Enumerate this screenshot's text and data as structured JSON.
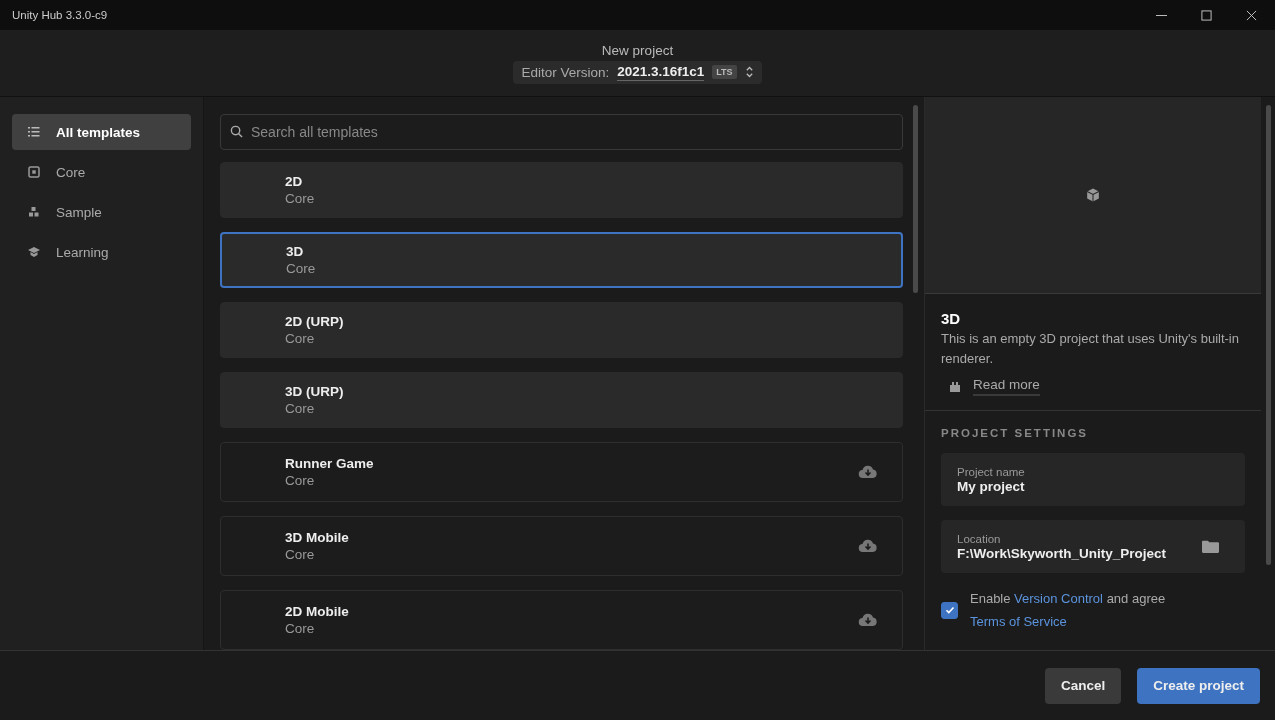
{
  "window": {
    "title": "Unity Hub 3.3.0-c9"
  },
  "header": {
    "title": "New project",
    "editor_label": "Editor Version:",
    "editor_version": "2021.3.16f1c1",
    "badge": "LTS"
  },
  "sidebar": {
    "items": [
      {
        "label": "All templates",
        "kind": "list",
        "selected": true
      },
      {
        "label": "Core",
        "kind": "core",
        "selected": false
      },
      {
        "label": "Sample",
        "kind": "sample",
        "selected": false
      },
      {
        "label": "Learning",
        "kind": "learning",
        "selected": false
      }
    ]
  },
  "search": {
    "placeholder": "Search all templates"
  },
  "templates": [
    {
      "name": "2D",
      "category": "Core",
      "kind": "installed",
      "selected": false
    },
    {
      "name": "3D",
      "category": "Core",
      "kind": "installed",
      "selected": true
    },
    {
      "name": "2D (URP)",
      "category": "Core",
      "kind": "installed",
      "selected": false
    },
    {
      "name": "3D (URP)",
      "category": "Core",
      "kind": "installed",
      "selected": false
    },
    {
      "name": "Runner Game",
      "category": "Core",
      "kind": "download",
      "selected": false
    },
    {
      "name": "3D Mobile",
      "category": "Core",
      "kind": "download",
      "selected": false
    },
    {
      "name": "2D Mobile",
      "category": "Core",
      "kind": "download",
      "selected": false
    }
  ],
  "details": {
    "title": "3D",
    "description": "This is an empty 3D project that uses Unity's built-in renderer.",
    "read_more": "Read more"
  },
  "project_settings": {
    "heading": "PROJECT SETTINGS",
    "fields": [
      {
        "label": "Project name",
        "value": "My project",
        "kind": "text"
      },
      {
        "label": "Location",
        "value": "F:\\Work\\Skyworth_Unity_Project",
        "kind": "folder"
      }
    ],
    "agreement": {
      "checked": true,
      "parts": [
        {
          "text": "Enable",
          "kind": "plain"
        },
        {
          "text": "Version Control",
          "kind": "link"
        },
        {
          "text": "and agree",
          "kind": "plain"
        },
        {
          "text": "Terms of Service",
          "kind": "link"
        }
      ]
    }
  },
  "buttons": [
    {
      "label": "Cancel",
      "kind": "secondary"
    },
    {
      "label": "Create project",
      "kind": "primary"
    }
  ]
}
